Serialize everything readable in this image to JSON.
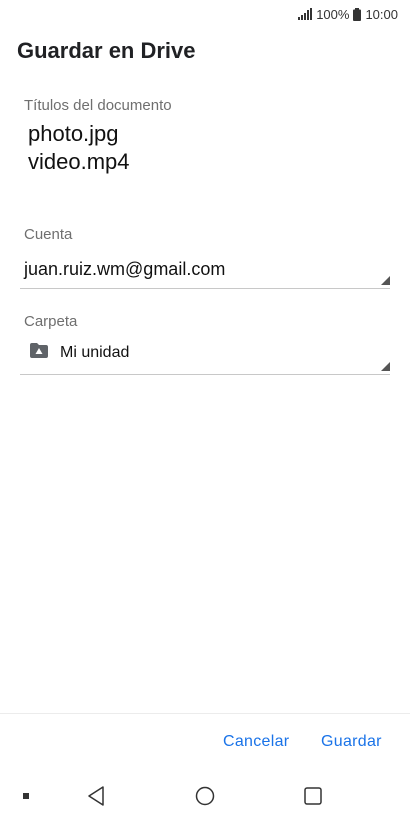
{
  "status_bar": {
    "battery_percent": "100%",
    "time": "10:00",
    "signal_icon": "signal-icon",
    "battery_icon": "battery-icon"
  },
  "dialog": {
    "title": "Guardar en Drive",
    "documents_label": "Títulos del documento",
    "documents": [
      "photo.jpg",
      "video.mp4"
    ],
    "account_label": "Cuenta",
    "account_value": "juan.ruiz.wm@gmail.com",
    "folder_label": "Carpeta",
    "folder_value": "Mi unidad",
    "folder_icon": "drive-folder-icon"
  },
  "actions": {
    "cancel_label": "Cancelar",
    "save_label": "Guardar",
    "accent_color": "#1a73e8"
  },
  "nav_bar": {
    "icons": [
      "dot-icon",
      "back-icon",
      "home-icon",
      "recents-icon"
    ]
  }
}
